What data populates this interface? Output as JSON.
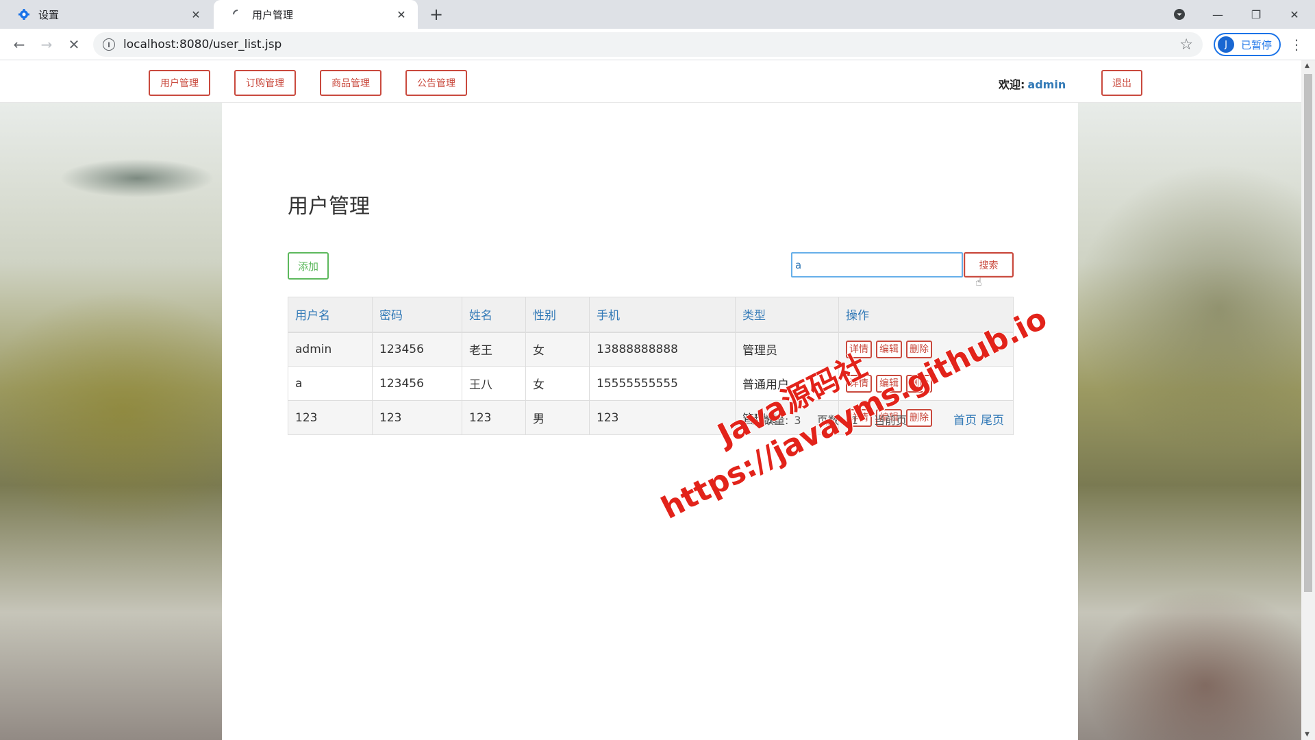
{
  "browser": {
    "tabs": [
      {
        "title": "设置",
        "icon": "gear-icon"
      },
      {
        "title": "用户管理",
        "icon": "loading-spinner-icon"
      }
    ],
    "url": "localhost:8080/user_list.jsp",
    "profile": {
      "initial": "J",
      "label": "已暂停"
    }
  },
  "nav": {
    "items": [
      "用户管理",
      "订购管理",
      "商品管理",
      "公告管理"
    ],
    "welcome_label": "欢迎:",
    "username": "admin",
    "logout": "退出"
  },
  "main": {
    "title": "用户管理",
    "add_label": "添加",
    "search_value": "a",
    "search_label": "搜索",
    "columns": [
      "用户名",
      "密码",
      "姓名",
      "性别",
      "手机",
      "类型",
      "操作"
    ],
    "rows": [
      [
        "admin",
        "123456",
        "老王",
        "女",
        "13888888888",
        "管理员"
      ],
      [
        "a",
        "123456",
        "王八",
        "女",
        "15555555555",
        "普通用户"
      ],
      [
        "123",
        "123",
        "123",
        "男",
        "123",
        "管理员"
      ]
    ],
    "actions": [
      "详情",
      "编辑",
      "删除"
    ],
    "pager": {
      "total_label": "总数量:",
      "total": "3",
      "pages_label": "页数",
      "pages": "1",
      "current_label": "当前页",
      "first": "首页",
      "last": "尾页"
    }
  },
  "watermark": {
    "line1": "Java源码社",
    "line2": "https://javayms.github.io"
  },
  "colors": {
    "accent_red": "#c9493d",
    "link_blue": "#337ab7",
    "add_green": "#5cb85c"
  }
}
